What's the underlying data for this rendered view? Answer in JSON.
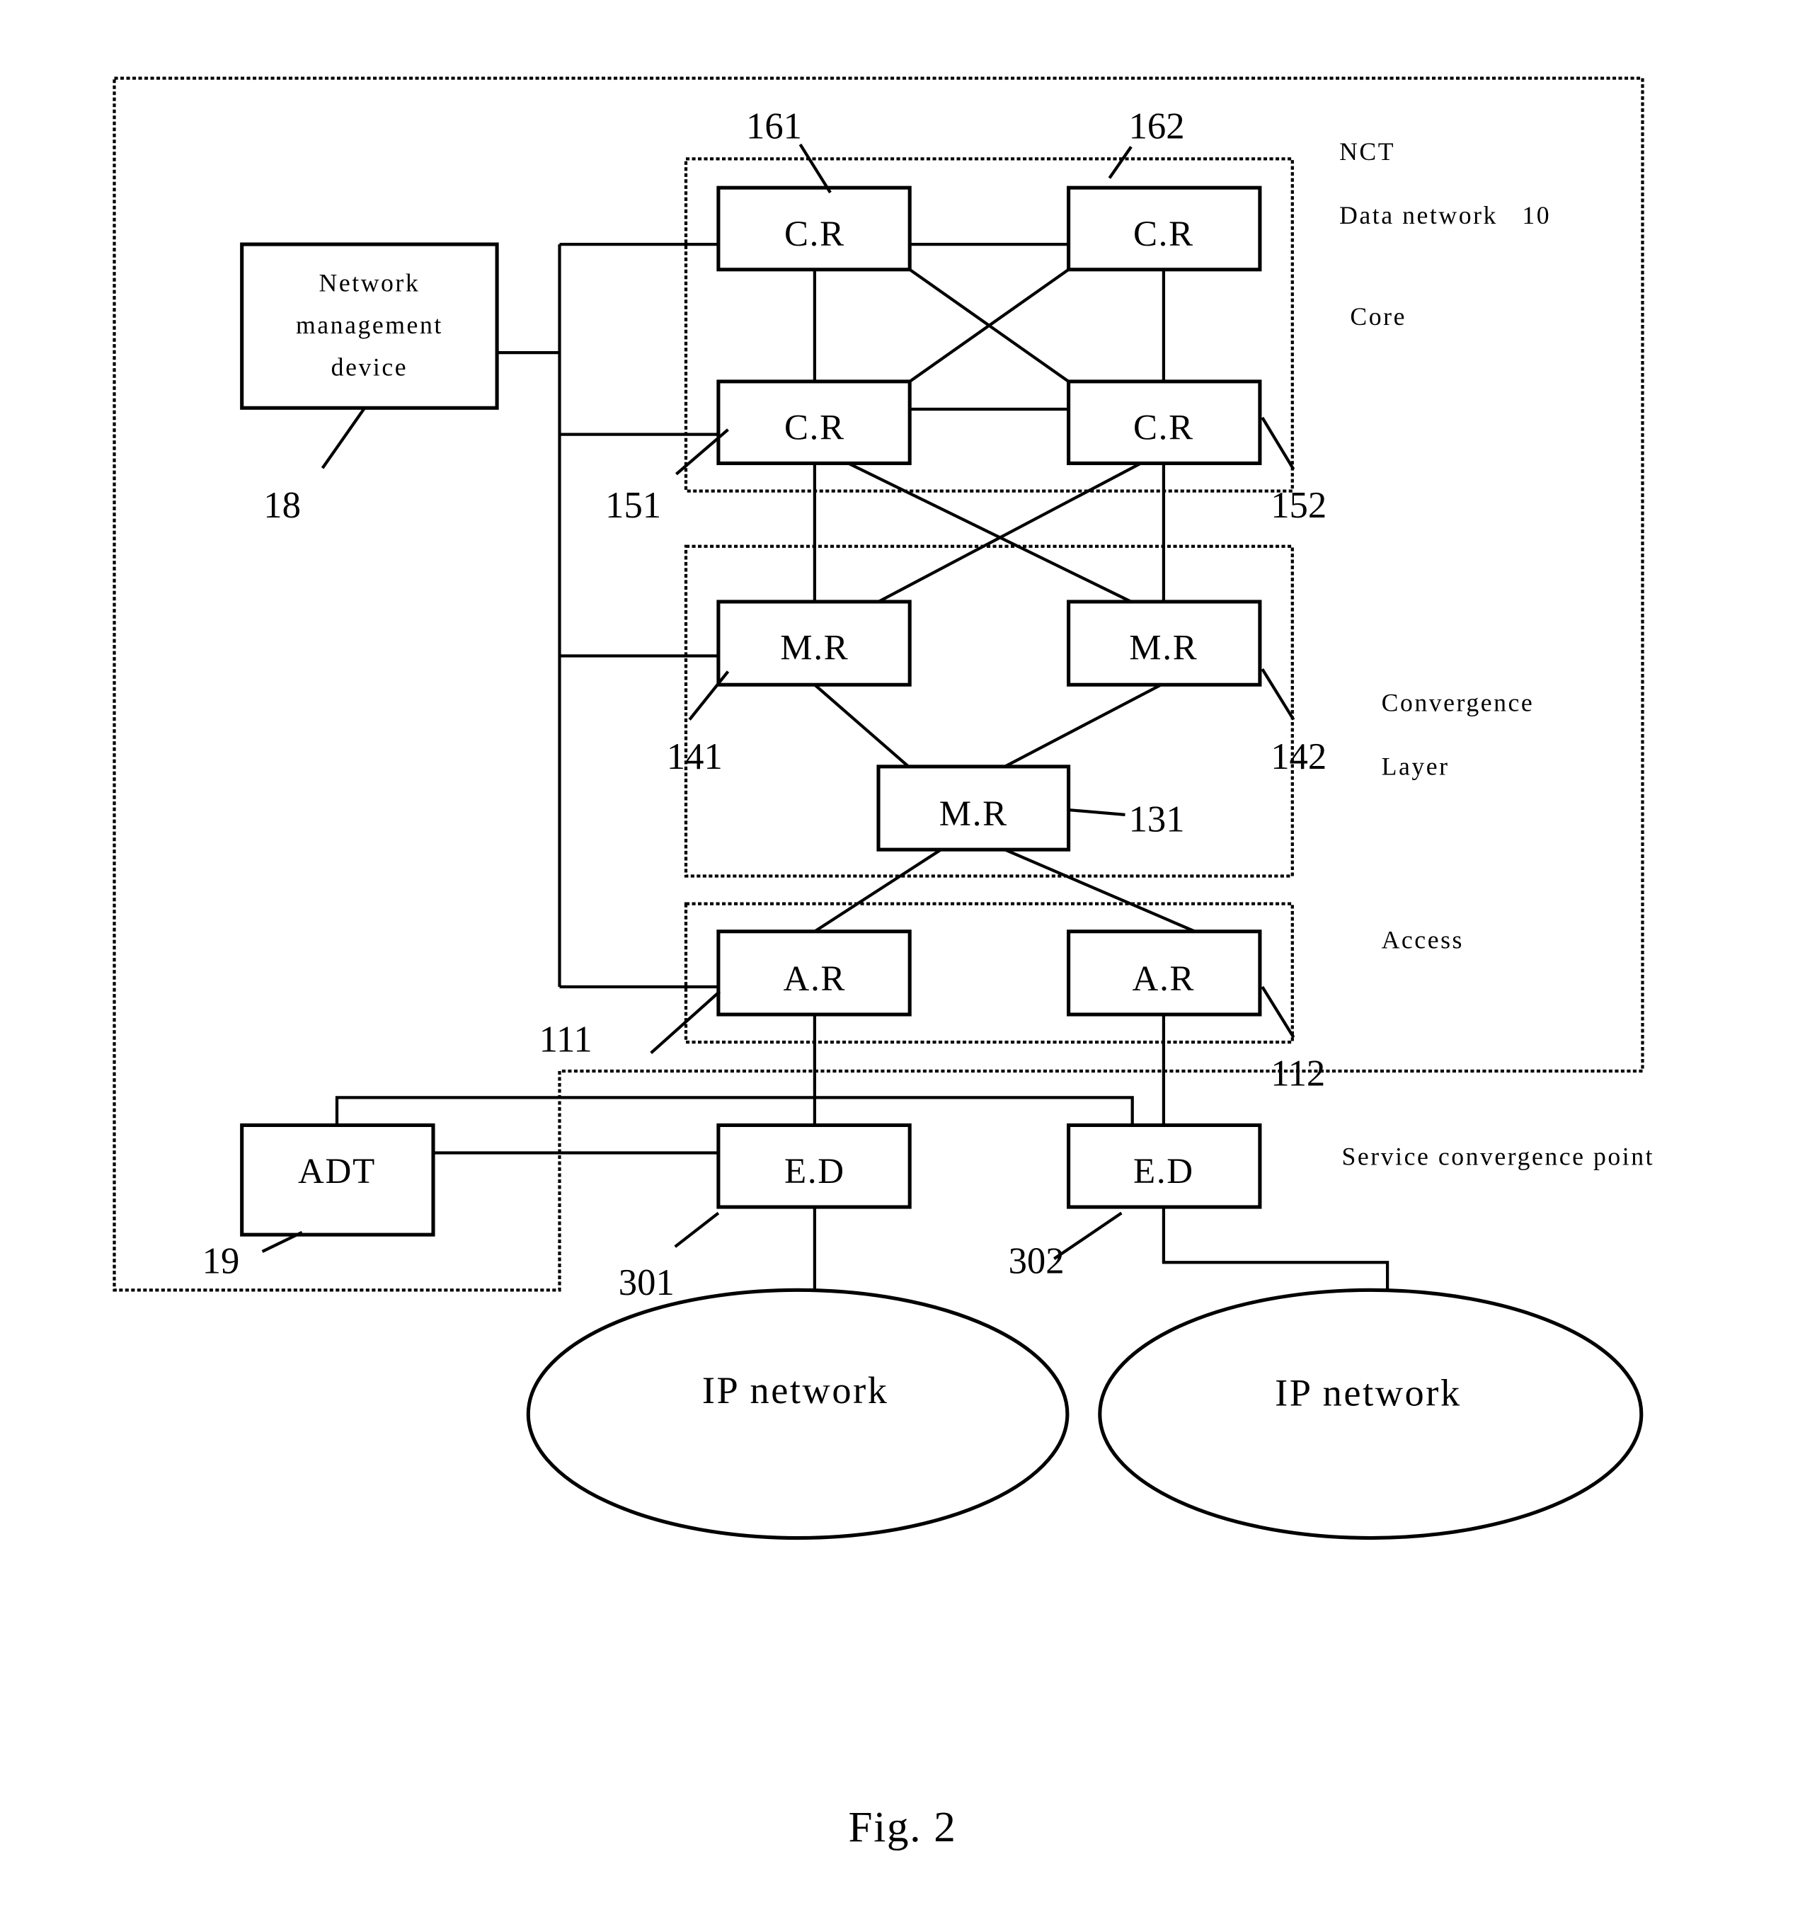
{
  "figure": {
    "caption": "Fig. 2",
    "region_labels": {
      "nct": "NCT",
      "data_network": "Data network   10",
      "core": "Core",
      "convergence": "Convergence",
      "layer": "Layer",
      "access": "Access",
      "service_convergence_point": "Service convergence point"
    },
    "nodes": {
      "nmd": {
        "lines": [
          "Network",
          "management",
          "device"
        ],
        "ref": "18"
      },
      "cr161": {
        "label": "C.R",
        "ref": "161"
      },
      "cr162": {
        "label": "C.R",
        "ref": "162"
      },
      "cr151": {
        "label": "C.R",
        "ref": "151"
      },
      "cr152": {
        "label": "C.R",
        "ref": "152"
      },
      "mr141": {
        "label": "M.R",
        "ref": "141"
      },
      "mr142": {
        "label": "M.R",
        "ref": "142"
      },
      "mr131": {
        "label": "M.R",
        "ref": "131"
      },
      "ar111": {
        "label": "A.R",
        "ref": "111"
      },
      "ar112": {
        "label": "A.R",
        "ref": "112"
      },
      "adt": {
        "label": "ADT",
        "ref": "19"
      },
      "ed301": {
        "label": "E.D",
        "ref": "301"
      },
      "ed302": {
        "label": "E.D",
        "ref": "302"
      },
      "ip1": {
        "label": "IP network"
      },
      "ip2": {
        "label": "IP network"
      }
    },
    "connections": [
      [
        "nmd",
        "bus"
      ],
      [
        "bus",
        "cr161"
      ],
      [
        "bus",
        "cr151"
      ],
      [
        "bus",
        "mr141"
      ],
      [
        "bus",
        "ar111"
      ],
      [
        "cr161",
        "cr162"
      ],
      [
        "cr161",
        "cr151"
      ],
      [
        "cr161",
        "cr152"
      ],
      [
        "cr162",
        "cr151"
      ],
      [
        "cr162",
        "cr152"
      ],
      [
        "cr151",
        "cr152"
      ],
      [
        "cr151",
        "mr141"
      ],
      [
        "cr151",
        "mr142"
      ],
      [
        "cr152",
        "mr141"
      ],
      [
        "cr152",
        "mr142"
      ],
      [
        "mr141",
        "mr131"
      ],
      [
        "mr142",
        "mr131"
      ],
      [
        "mr131",
        "ar111"
      ],
      [
        "mr131",
        "ar112"
      ],
      [
        "ar111",
        "ed301"
      ],
      [
        "ar112",
        "ed302"
      ],
      [
        "adt",
        "ed301"
      ],
      [
        "adt",
        "ed302"
      ],
      [
        "ed301",
        "ip1"
      ],
      [
        "ed302",
        "ip2"
      ]
    ]
  }
}
